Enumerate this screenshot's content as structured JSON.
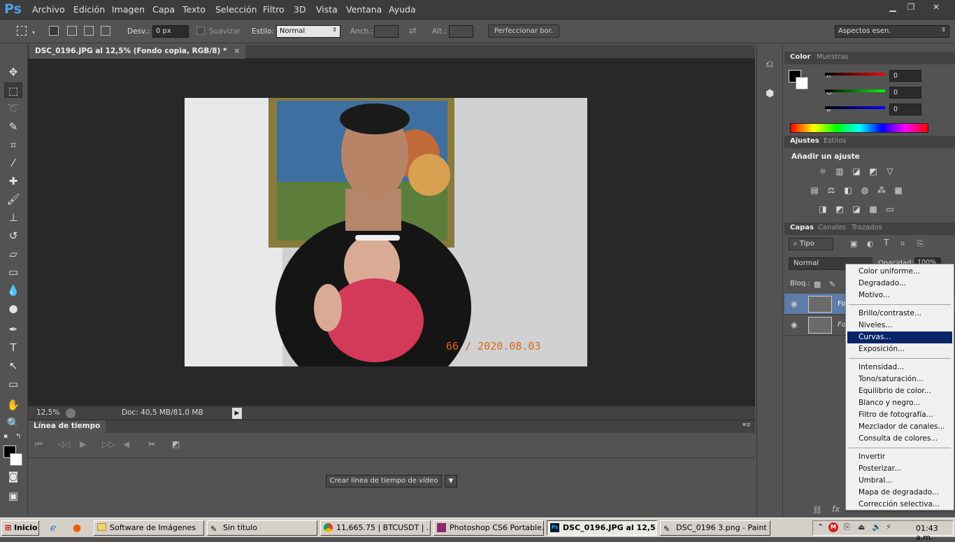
{
  "app": {
    "logo": "Ps",
    "accent": "#4fa0e8"
  },
  "menu": [
    "Archivo",
    "Edición",
    "Imagen",
    "Capa",
    "Texto",
    "Selección",
    "Filtro",
    "3D",
    "Vista",
    "Ventana",
    "Ayuda"
  ],
  "window_controls": {
    "minimize": "▁",
    "restore": "❐",
    "close": "✕"
  },
  "options": {
    "feather_label": "Desv.:",
    "feather_value": "0 px",
    "antialias_label": "Suavizar",
    "style_label": "Estilo:",
    "style_value": "Normal",
    "width_label": "Anch.:",
    "height_label": "Alt.:",
    "refine_button": "Perfeccionar bor.",
    "workspace": "Aspectos esen."
  },
  "document": {
    "tab_title": "DSC_0196.JPG al 12,5% (Fondo copia, RGB/8) *",
    "photo_stamp": "66 / 2020.08.03",
    "zoom": "12,5%",
    "doc_size": "Doc: 40,5 MB/81,0 MB"
  },
  "timeline": {
    "tab_label": "Línea de tiempo",
    "create_button": "Crear línea de tiempo de vídeo"
  },
  "color_panel": {
    "tabs": [
      "Color",
      "Muestras"
    ],
    "channels": [
      {
        "label": "R",
        "value": "0"
      },
      {
        "label": "G",
        "value": "0"
      },
      {
        "label": "B",
        "value": "0"
      }
    ]
  },
  "adjust_panel": {
    "tabs": [
      "Ajustes",
      "Estilos"
    ],
    "title": "Añadir un ajuste"
  },
  "layers_panel": {
    "tabs": [
      "Capas",
      "Canales",
      "Trazados"
    ],
    "filter": "Tipo",
    "blend_mode": "Normal",
    "opacity_label": "Opacidad:",
    "opacity_value": "100%",
    "lock_label": "Bloq.:",
    "layers": [
      {
        "name": "Fo"
      },
      {
        "name": "Fo"
      }
    ]
  },
  "context_menu": {
    "group1": [
      "Color uniforme...",
      "Degradado...",
      "Motivo..."
    ],
    "group2": [
      "Brillo/contraste...",
      "Niveles...",
      "Curvas...",
      "Exposición..."
    ],
    "group3": [
      "Intensidad...",
      "Tono/saturación...",
      "Equilibrio de color...",
      "Blanco y negro...",
      "Filtro de fotografía...",
      "Mezclador de canales...",
      "Consulta de colores..."
    ],
    "group4": [
      "Invertir",
      "Posterizar...",
      "Umbral...",
      "Mapa de degradado...",
      "Corrección selectiva..."
    ],
    "highlighted": "Curvas..."
  },
  "taskbar": {
    "start": "Inicio",
    "tasks": [
      "Software de Imágenes",
      "Sin título",
      "11,665.75 | BTCUSDT | ...",
      "Photoshop CS6 Portable....",
      "DSC_0196.JPG al 12,5...",
      "DSC_0196 3.png - Paint"
    ],
    "clock": "01:43 a.m."
  }
}
